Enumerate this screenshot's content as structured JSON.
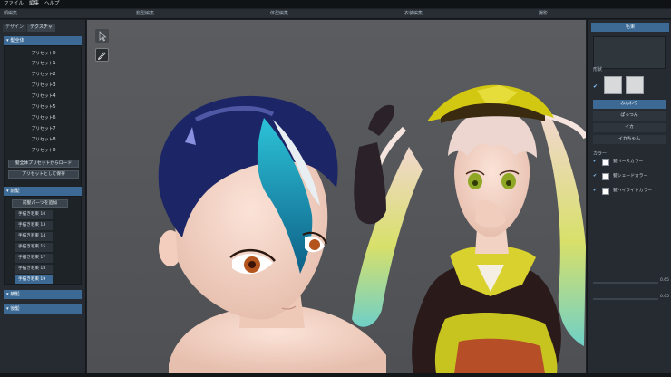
{
  "menu": [
    "ファイル",
    "編集",
    "ヘルプ"
  ],
  "sections": [
    "顔編集",
    "髪型編集",
    "体型編集",
    "衣装編集",
    "撮影"
  ],
  "left_panel": {
    "tabs": [
      "デザイン",
      "テクスチャ"
    ],
    "all_section": {
      "title": "髪全体",
      "presets": [
        "プリセット0",
        "プリセット1",
        "プリセット2",
        "プリセット3",
        "プリセット4",
        "プリセット5",
        "プリセット6",
        "プリセット7",
        "プリセット8",
        "プリセット9"
      ],
      "load_button": "髪全体プリセットからロード",
      "save_button": "プリセットとして保存"
    },
    "front_section": {
      "title": "前髪",
      "add_button": "前髪パーツを追加",
      "items": [
        "手描き毛束 10",
        "手描き毛束 13",
        "手描き毛束 14",
        "手描き毛束 15",
        "手描き毛束 17",
        "手描き毛束 18",
        "手描き毛束 19"
      ],
      "selected": "手描き毛束 19"
    },
    "side_section": {
      "title": "横髪"
    },
    "back_section": {
      "title": "後髪"
    }
  },
  "right_panel": {
    "title": "毛束",
    "shape_label": "形状",
    "styles": [
      "ふんわり",
      "ぱっつん",
      "イカ",
      "イカちゃん"
    ],
    "selected_style": "ふんわり",
    "color_label": "カラー",
    "colors": [
      {
        "name": "髪ベースカラー",
        "hex": "#ffffff"
      },
      {
        "name": "髪シェードカラー",
        "hex": "#ffffff"
      },
      {
        "name": "髪ハイライトカラー",
        "hex": "#ffffff"
      }
    ],
    "slider_values": [
      "0.65",
      "0.65"
    ]
  },
  "colors": {
    "accent": "#3d6a95",
    "panel": "#252b31",
    "viewport": "#55575b",
    "hair_navy": "#1c2565",
    "hair_teal": "#1a8fb0"
  }
}
